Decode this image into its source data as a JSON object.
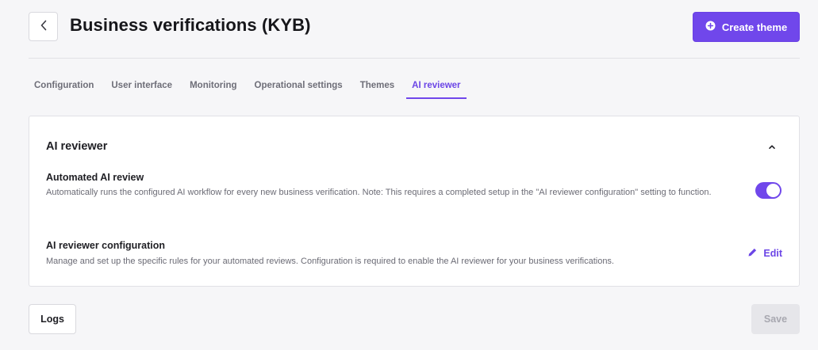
{
  "header": {
    "title": "Business verifications (KYB)",
    "back_icon": "chevron-left-icon",
    "create_button_label": "Create theme",
    "create_button_icon": "plus-circle-icon"
  },
  "tabs": [
    {
      "label": "Configuration",
      "active": false
    },
    {
      "label": "User interface",
      "active": false
    },
    {
      "label": "Monitoring",
      "active": false
    },
    {
      "label": "Operational settings",
      "active": false
    },
    {
      "label": "Themes",
      "active": false
    },
    {
      "label": "AI reviewer",
      "active": true
    }
  ],
  "card": {
    "title": "AI reviewer",
    "collapse_icon": "chevron-up-icon",
    "automated_review": {
      "title": "Automated AI review",
      "description": "Automatically runs the configured AI workflow for every new business verification. Note: This requires a completed setup in the \"AI reviewer configuration\" setting to function.",
      "toggle_on": true
    },
    "configuration": {
      "title": "AI reviewer configuration",
      "description": "Manage and set up the specific rules for your automated reviews. Configuration is required to enable the AI reviewer for your business verifications.",
      "edit_label": "Edit",
      "edit_icon": "pencil-icon"
    }
  },
  "footer": {
    "logs_label": "Logs",
    "save_label": "Save",
    "save_disabled": true
  },
  "colors": {
    "accent": "#7047eb",
    "background": "#f6f6f8",
    "disabled": "#e6e6ea"
  }
}
